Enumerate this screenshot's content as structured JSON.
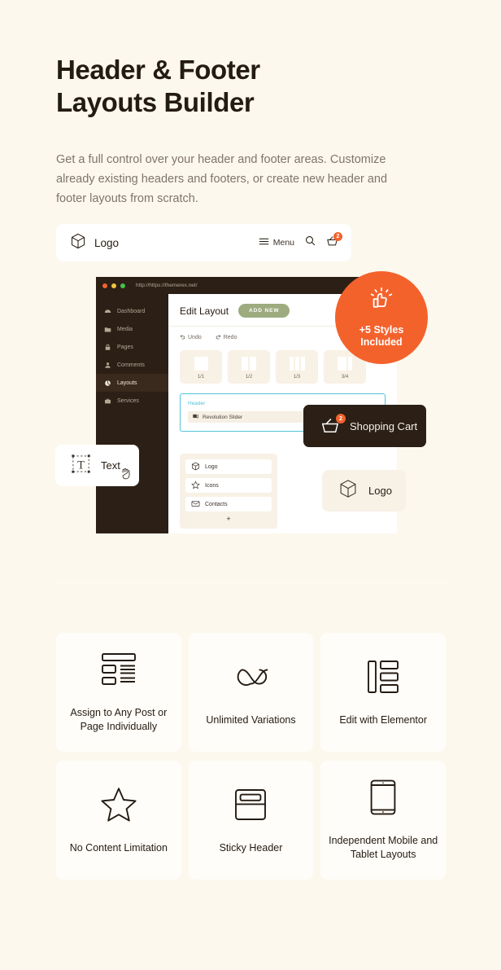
{
  "intro": {
    "headline_line1": "Header & Footer",
    "headline_line2": "Layouts Builder",
    "subtext": "Get a full control over your header and footer areas. Customize already existing headers and footers, or create new header and footer layouts from scratch."
  },
  "header_bar": {
    "logo_text": "Logo",
    "menu_label": "Menu",
    "cart_count": "2",
    "icons": [
      "cube-logo-icon",
      "hamburger-icon",
      "search-icon",
      "cart-icon"
    ]
  },
  "browser": {
    "url": "http://https://themerex.net/",
    "window_dots": [
      "red-dot",
      "yellow-dot",
      "green-dot"
    ],
    "sidebar": [
      {
        "label": "Dashboard",
        "icon": "dashboard-icon",
        "active": false
      },
      {
        "label": "Media",
        "icon": "media-icon",
        "active": false
      },
      {
        "label": "Pages",
        "icon": "lock-icon",
        "active": false
      },
      {
        "label": "Comments",
        "icon": "user-icon",
        "active": false
      },
      {
        "label": "Layouts",
        "icon": "layouts-icon",
        "active": true
      },
      {
        "label": "Services",
        "icon": "briefcase-icon",
        "active": false
      }
    ],
    "title": "Edit Layout",
    "add_new": "ADD NEW",
    "tools": [
      {
        "label": "Undo",
        "icon": "undo-icon"
      },
      {
        "label": "Redo",
        "icon": "redo-icon"
      }
    ],
    "columns": [
      {
        "label": "1/1",
        "parts": 1
      },
      {
        "label": "1/2",
        "parts": 2
      },
      {
        "label": "1/3",
        "parts": 3
      },
      {
        "label": "3/4",
        "parts": 2
      }
    ],
    "header_zone": {
      "title": "Header",
      "row_label": "Revolution Slider",
      "row_icon": "slider-icon"
    },
    "widgets": [
      {
        "label": "Logo",
        "icon": "cube-icon"
      },
      {
        "label": "Icons",
        "icon": "star-icon"
      },
      {
        "label": "Contacts",
        "icon": "envelope-icon"
      }
    ],
    "add_widget": "+"
  },
  "overlays": {
    "styles_badge": {
      "icon": "thumbs-up-icon",
      "line1": "+5 Styles",
      "line2": "Included"
    },
    "shopping_cart_card": {
      "label": "Shopping Cart",
      "icon": "cart-icon",
      "count": "2"
    },
    "text_card": {
      "label": "Text",
      "icon": "text-tool-icon",
      "cursor": "grab-hand-cursor"
    },
    "logo_card": {
      "label": "Logo",
      "icon": "cube-icon"
    }
  },
  "features": [
    {
      "label": "Assign to Any Post or Page Individually",
      "icon": "layout-blocks-icon"
    },
    {
      "label": "Unlimited Variations",
      "icon": "infinity-icon"
    },
    {
      "label": "Edit with Elementor",
      "icon": "elementor-icon"
    },
    {
      "label": "No Content Limitation",
      "icon": "star-outline-icon"
    },
    {
      "label": "Sticky Header",
      "icon": "sticky-header-icon"
    },
    {
      "label": "Independent Mobile and Tablet Layouts",
      "icon": "tablet-icon"
    }
  ],
  "colors": {
    "background": "#fdf8ed",
    "accent": "#f4622c",
    "dark": "#2b1f16",
    "green": "#9dab7e",
    "cyan": "#4fc3dc",
    "card": "#fffdf9"
  }
}
